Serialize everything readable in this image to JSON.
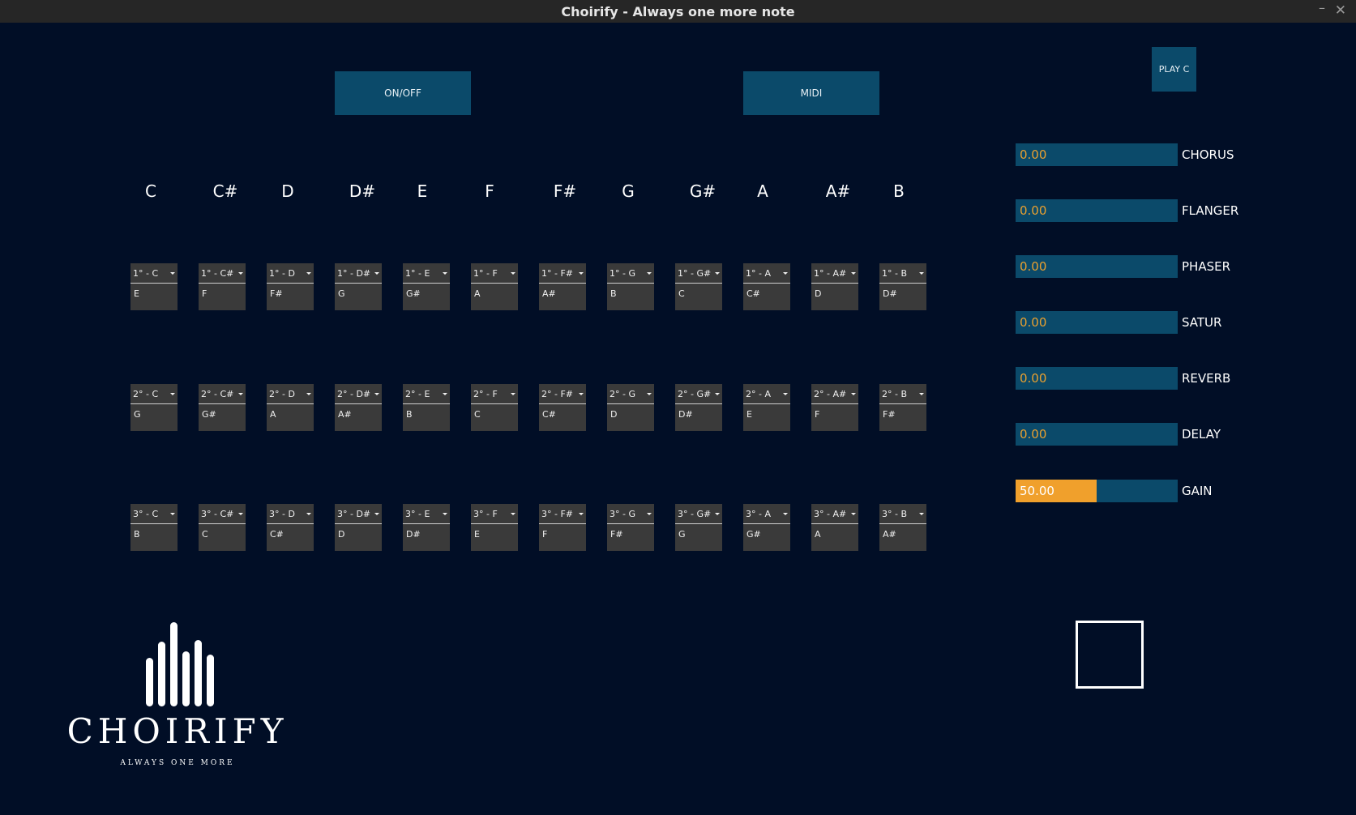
{
  "window": {
    "title": "Choirify - Always one more note",
    "minimize_glyph": "–",
    "close_glyph": "✕"
  },
  "buttons": {
    "onoff": "ON/OFF",
    "midi": "MIDI",
    "play": "PLAY C"
  },
  "notes": [
    "C",
    "C#",
    "D",
    "D#",
    "E",
    "F",
    "F#",
    "G",
    "G#",
    "A",
    "A#",
    "B"
  ],
  "rows": [
    {
      "labels": [
        "1° - C",
        "1° - C#",
        "1° - D",
        "1° - D#",
        "1° - E",
        "1° - F",
        "1° - F#",
        "1° - G",
        "1° - G#",
        "1° - A",
        "1° - A#",
        "1° - B"
      ],
      "values": [
        "E",
        "F",
        "F#",
        "G",
        "G#",
        "A",
        "A#",
        "B",
        "C",
        "C#",
        "D",
        "D#"
      ]
    },
    {
      "labels": [
        "2° - C",
        "2° - C#",
        "2° - D",
        "2° - D#",
        "2° - E",
        "2° - F",
        "2° - F#",
        "2° - G",
        "2° - G#",
        "2° - A",
        "2° - A#",
        "2° - B"
      ],
      "values": [
        "G",
        "G#",
        "A",
        "A#",
        "B",
        "C",
        "C#",
        "D",
        "D#",
        "E",
        "F",
        "F#"
      ]
    },
    {
      "labels": [
        "3° - C",
        "3° - C#",
        "3° - D",
        "3° - D#",
        "3° - E",
        "3° - F",
        "3° - F#",
        "3° - G",
        "3° - G#",
        "3° - A",
        "3° - A#",
        "3° - B"
      ],
      "values": [
        "B",
        "C",
        "C#",
        "D",
        "D#",
        "E",
        "F",
        "F#",
        "G",
        "G#",
        "A",
        "A#"
      ]
    }
  ],
  "sliders": [
    {
      "label": "CHORUS",
      "value": "0.00",
      "level": 0
    },
    {
      "label": "FLANGER",
      "value": "0.00",
      "level": 0
    },
    {
      "label": "PHASER",
      "value": "0.00",
      "level": 0
    },
    {
      "label": "SATUR",
      "value": "0.00",
      "level": 0
    },
    {
      "label": "REVERB",
      "value": "0.00",
      "level": 0
    },
    {
      "label": "DELAY",
      "value": "0.00",
      "level": 0
    },
    {
      "label": "GAIN",
      "value": "50.00",
      "level": 0.5
    }
  ],
  "logo": {
    "word": "CHOIRIFY",
    "tagline": "ALWAYS ONE MORE"
  },
  "colors": {
    "background": "#010e26",
    "button": "#0b4a6a",
    "accent": "#f0a02c",
    "combo": "#3a3a3a"
  }
}
